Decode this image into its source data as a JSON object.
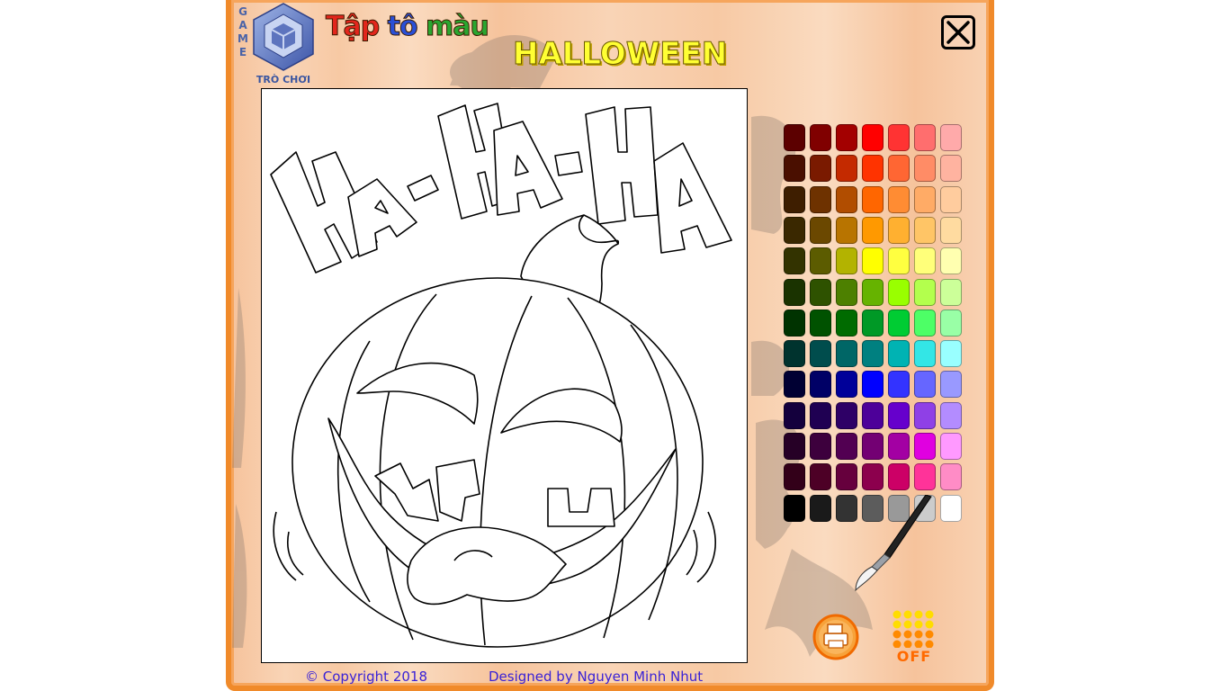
{
  "logo": {
    "vertical_text": [
      "G",
      "A",
      "M",
      "E"
    ],
    "caption": "TRÒ CHƠI"
  },
  "title": {
    "words": [
      {
        "text": "Tập",
        "color": "#e2261c"
      },
      {
        "text": " ",
        "color": "#ffffff"
      },
      {
        "text": "tô",
        "color": "#2a4fd6"
      },
      {
        "text": " ",
        "color": "#ffffff"
      },
      {
        "text": "màu",
        "color": "#2aa630"
      }
    ],
    "subtitle": "HALLOWEEN"
  },
  "close_button": {
    "icon": "close-icon"
  },
  "drawing": {
    "text": "HA-HA-HA",
    "subject": "pumpkin-lineart"
  },
  "palette": {
    "rows": [
      [
        "#5c0000",
        "#800000",
        "#a30000",
        "#ff0000",
        "#ff3333",
        "#ff6e6e",
        "#ffaaaa"
      ],
      [
        "#4a0f00",
        "#7a1a00",
        "#c42a00",
        "#ff3300",
        "#ff6633",
        "#ff8c66",
        "#ffb3a0"
      ],
      [
        "#3e1e00",
        "#6e3200",
        "#b14d00",
        "#ff6600",
        "#ff8c33",
        "#ffab66",
        "#ffcc9e"
      ],
      [
        "#3a2800",
        "#6b4800",
        "#b87400",
        "#ff9900",
        "#ffb030",
        "#ffc566",
        "#ffdba0"
      ],
      [
        "#333300",
        "#5c5c00",
        "#b3b300",
        "#ffff00",
        "#ffff40",
        "#ffff7a",
        "#ffffb0"
      ],
      [
        "#1a3300",
        "#2e5200",
        "#4d8000",
        "#66b300",
        "#99ff00",
        "#b3ff4d",
        "#ccff99"
      ],
      [
        "#003300",
        "#005200",
        "#006b00",
        "#009926",
        "#00cc33",
        "#4dff66",
        "#99ffa6"
      ],
      [
        "#00332e",
        "#004d4d",
        "#006666",
        "#008080",
        "#00b3b3",
        "#33e6e6",
        "#99ffff"
      ],
      [
        "#000033",
        "#000066",
        "#000099",
        "#0000ff",
        "#3333ff",
        "#6666ff",
        "#9999ff"
      ],
      [
        "#14003d",
        "#1f0052",
        "#2e0066",
        "#4d0099",
        "#6600cc",
        "#8f40e6",
        "#b38cff"
      ],
      [
        "#260026",
        "#3d003d",
        "#520052",
        "#730073",
        "#a300a3",
        "#e000e0",
        "#ff99ff"
      ],
      [
        "#330019",
        "#4d0026",
        "#66003d",
        "#8c004d",
        "#cc0066",
        "#ff3399",
        "#ff8cc6"
      ],
      [
        "#000000",
        "#1a1a1a",
        "#333333",
        "#5c5c5c",
        "#999999",
        "#cccccc",
        "#ffffff"
      ]
    ]
  },
  "tools": {
    "brush_icon": "paintbrush-icon",
    "print_icon": "printer-icon",
    "sound_label": "OFF",
    "sound_icon": "sound-dots-icon"
  },
  "footer": {
    "copyright": "© Copyright 2018",
    "designer": "Designed by Nguyen Minh Nhut"
  }
}
